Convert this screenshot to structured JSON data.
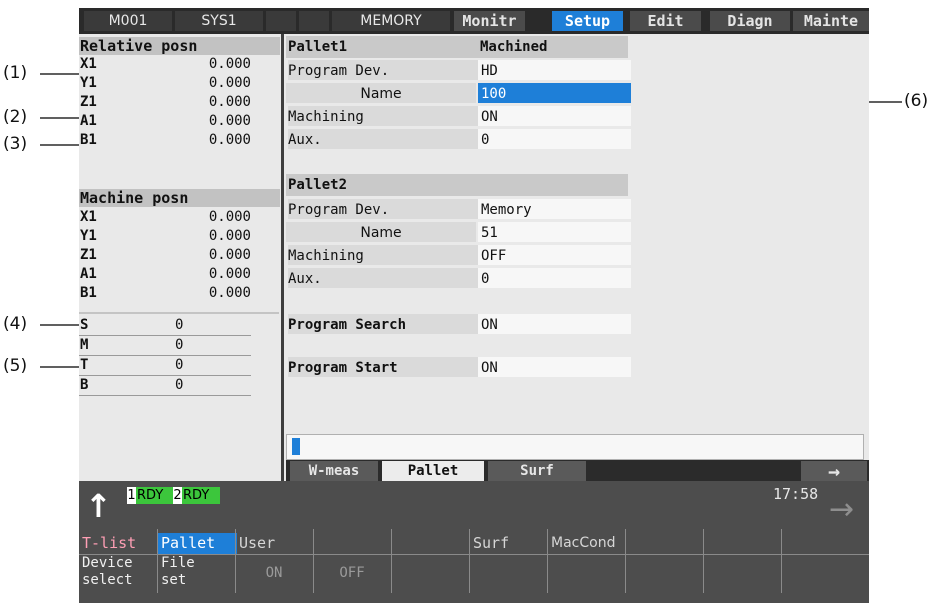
{
  "top_bar": {
    "machine": "M001",
    "system": "SYS1",
    "mode": "MEMORY",
    "menus": [
      "Monitr",
      "Setup",
      "Edit",
      "Diagn",
      "Mainte"
    ],
    "active_menu": "Setup"
  },
  "left_panel": {
    "relative_title": "Relative posn",
    "relative": [
      {
        "axis": "X1",
        "value": "0.000"
      },
      {
        "axis": "Y1",
        "value": "0.000"
      },
      {
        "axis": "Z1",
        "value": "0.000"
      },
      {
        "axis": "A1",
        "value": "0.000"
      },
      {
        "axis": "B1",
        "value": "0.000"
      }
    ],
    "machine_title": "Machine posn",
    "machine": [
      {
        "axis": "X1",
        "value": "0.000"
      },
      {
        "axis": "Y1",
        "value": "0.000"
      },
      {
        "axis": "Z1",
        "value": "0.000"
      },
      {
        "axis": "A1",
        "value": "0.000"
      },
      {
        "axis": "B1",
        "value": "0.000"
      }
    ],
    "smtb": [
      {
        "code": "S",
        "value": "0"
      },
      {
        "code": "M",
        "value": "0"
      },
      {
        "code": "T",
        "value": "0"
      },
      {
        "code": "B",
        "value": "0"
      }
    ]
  },
  "pallet1": {
    "title": "Pallet1",
    "status": "Machined",
    "program_dev_label": "Program Dev.",
    "program_dev": "HD",
    "name_label": "Name",
    "name": "100",
    "machining_label": "Machining",
    "machining": "ON",
    "aux_label": "Aux.",
    "aux": "0"
  },
  "pallet2": {
    "title": "Pallet2",
    "program_dev_label": "Program Dev.",
    "program_dev": "Memory",
    "name_label": "Name",
    "name": "51",
    "machining_label": "Machining",
    "machining": "OFF",
    "aux_label": "Aux.",
    "aux": "0"
  },
  "program_search": {
    "label": "Program Search",
    "value": "ON"
  },
  "program_start": {
    "label": "Program Start",
    "value": "ON"
  },
  "tabs": [
    "W-meas",
    "Pallet",
    "Surf"
  ],
  "active_tab": "Pallet",
  "tab_arrow": "→",
  "status": {
    "up_arrow": "↑",
    "sys1": "1",
    "rdy1": "RDY",
    "sys2": "2",
    "rdy2": "RDY",
    "time": "17:58",
    "right_arrow": "→"
  },
  "menu_keys": [
    {
      "top": "T-list",
      "bottom": "Device\nselect"
    },
    {
      "top": "Pallet",
      "bottom": "File\nset"
    },
    {
      "top": "User",
      "bottom": "ON"
    },
    {
      "top": "",
      "bottom": "OFF"
    },
    {
      "top": "",
      "bottom": ""
    },
    {
      "top": "Surf",
      "bottom": ""
    },
    {
      "top": "MacCond",
      "bottom": ""
    },
    {
      "top": "",
      "bottom": ""
    },
    {
      "top": "",
      "bottom": ""
    },
    {
      "top": "",
      "bottom": ""
    }
  ],
  "callouts": [
    "(1)",
    "(2)",
    "(3)",
    "(4)",
    "(5)",
    "(6)"
  ],
  "colors": {
    "accent_blue": "#1e7fd8",
    "ready_green": "#3cc63c",
    "tlist_pink": "#ff9fb5"
  }
}
